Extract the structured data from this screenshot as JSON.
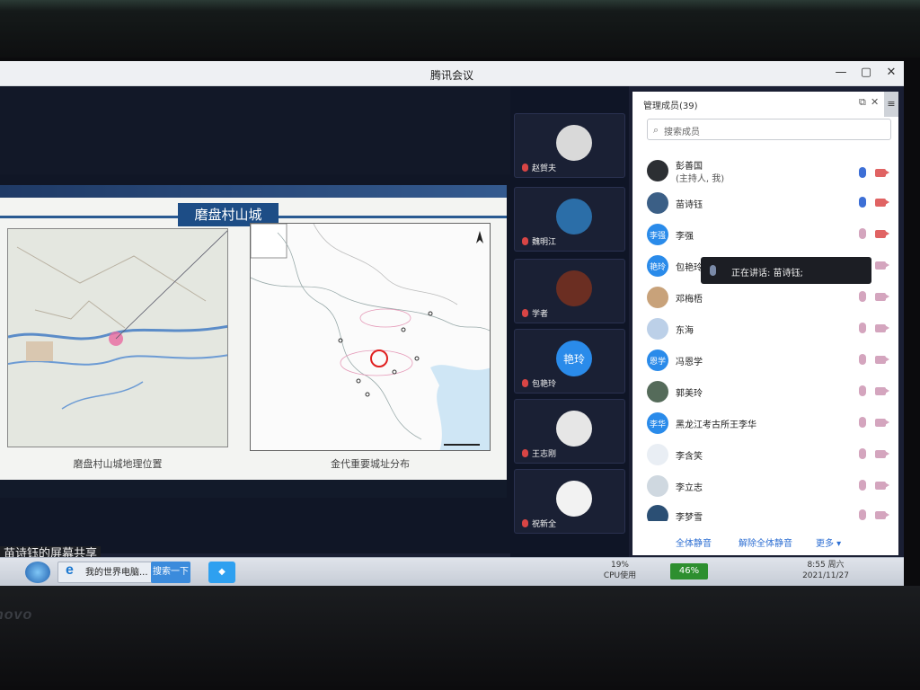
{
  "app": {
    "title": "腾讯会议",
    "window_buttons": [
      "—",
      "▢",
      "✕"
    ]
  },
  "slide": {
    "title": "磨盘村山城",
    "caption_left": "磨盘村山城地理位置",
    "caption_right": "金代重要城址分布"
  },
  "share_label": "苗诗钰的屏幕共享",
  "video_tiles": [
    {
      "name": "赵賀夫",
      "avatar_color": "#d9d9d9"
    },
    {
      "name": "魏明江",
      "avatar_color": "#2b6ea8"
    },
    {
      "name": "学者",
      "avatar_color": "#6b2e22"
    },
    {
      "name": "包艳玲",
      "avatar_color": "#2a8bea",
      "avatar_text": "艳玲"
    },
    {
      "name": "王志刚",
      "avatar_color": "#e6e6e6"
    },
    {
      "name": "祝新全",
      "avatar_color": "#f2f2f2"
    }
  ],
  "panel": {
    "title": "管理成员(39)",
    "search_placeholder": "搜索成员",
    "members": [
      {
        "name": "彭善国",
        "sub": "(主持人, 我)",
        "avatar_color": "#2c2f33",
        "state": "active"
      },
      {
        "name": "苗诗钰",
        "avatar_color": "#3b5f86",
        "state": "active"
      },
      {
        "name": "李强",
        "avatar_color": "#2a8bea",
        "avatar_text": "李强",
        "state": "muted-video"
      },
      {
        "name": "包艳玲",
        "avatar_color": "#2a8bea",
        "avatar_text": "艳玲",
        "state": "muted"
      },
      {
        "name": "邓梅梧",
        "avatar_color": "#c8a27a",
        "state": "muted"
      },
      {
        "name": "东海",
        "avatar_color": "#bcd0e8",
        "state": "muted"
      },
      {
        "name": "冯恩学",
        "avatar_color": "#2a8bea",
        "avatar_text": "恩学",
        "state": "muted"
      },
      {
        "name": "郭美玲",
        "avatar_color": "#556b5a",
        "state": "muted"
      },
      {
        "name": "黑龙江考古所王李华",
        "avatar_color": "#2a8bea",
        "avatar_text": "李华",
        "state": "muted"
      },
      {
        "name": "李含笑",
        "avatar_color": "#e9eef4",
        "state": "muted"
      },
      {
        "name": "李立志",
        "avatar_color": "#cfd8e0",
        "state": "muted"
      },
      {
        "name": "李梦雪",
        "avatar_color": "#2b4f74",
        "state": "muted"
      }
    ],
    "tooltip": "正在讲话: 苗诗钰;",
    "footer": {
      "mute_all": "全体静音",
      "unmute_all": "解除全体静音",
      "more": "更多 ▾"
    }
  },
  "taskbar": {
    "browser_label": "我的世界电脑...",
    "search_label": "搜索一下",
    "cpu_value": "19%",
    "cpu_label": "CPU使用",
    "battery": "46%",
    "time": "8:55 周六",
    "date": "2021/11/27"
  },
  "colors": {
    "accent": "#2e6fd3",
    "slide_title_bg": "#1d4d86",
    "tooltip_bg": "#1c1e24"
  }
}
